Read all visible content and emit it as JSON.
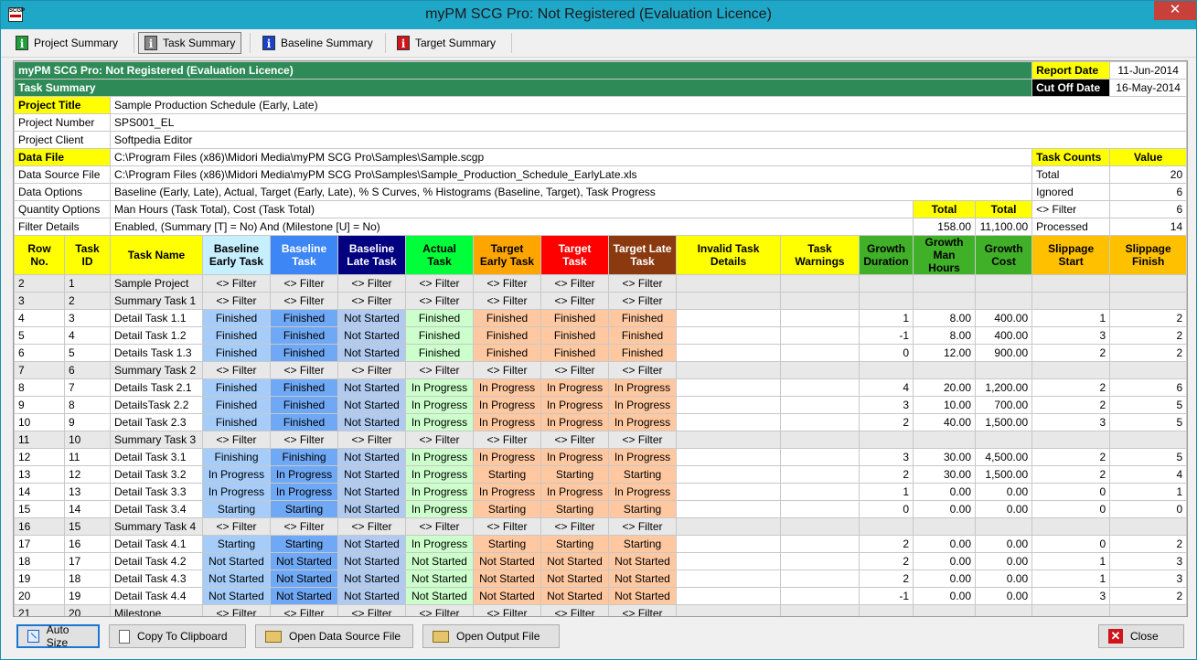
{
  "window": {
    "title": "myPM SCG Pro: Not Registered (Evaluation Licence)",
    "close": "✕"
  },
  "toolbar": [
    {
      "label": "Project Summary",
      "icon": "info-green-icon",
      "active": false
    },
    {
      "label": "Task Summary",
      "icon": "info-gray-icon",
      "active": true
    },
    {
      "label": "Baseline Summary",
      "icon": "info-blue-icon",
      "active": false
    },
    {
      "label": "Target Summary",
      "icon": "info-red-icon",
      "active": false
    }
  ],
  "header": {
    "app_line": "myPM SCG Pro: Not Registered (Evaluation Licence)",
    "sheet_title": "Task Summary",
    "report_date_label": "Report Date",
    "report_date": "11-Jun-2014",
    "cutoff_label": "Cut Off Date",
    "cutoff_date": "16-May-2014"
  },
  "project": {
    "title_label": "Project Title",
    "title": "Sample Production Schedule (Early, Late)",
    "number_label": "Project Number",
    "number": "SPS001_EL",
    "client_label": "Project Client",
    "client": "Softpedia Editor",
    "data_file_label": "Data File",
    "data_file": "C:\\Program Files (x86)\\Midori Media\\myPM SCG Pro\\Samples\\Sample.scgp",
    "source_label": "Data Source File",
    "source": "C:\\Program Files (x86)\\Midori Media\\myPM SCG Pro\\Samples\\Sample_Production_Schedule_EarlyLate.xls",
    "options_label": "Data Options",
    "options": "Baseline (Early, Late), Actual, Target (Early, Late), % S Curves, % Histograms (Baseline, Target), Task Progress",
    "qty_label": "Quantity Options",
    "qty": "Man Hours (Task Total), Cost (Task Total)",
    "filter_label": "Filter Details",
    "filter": "Enabled, (Summary [T] = No) And (Milestone [U] = No)"
  },
  "totals": {
    "label1": "Total",
    "label2": "Total",
    "value1": "158.00",
    "value2": "11,100.00"
  },
  "counts": {
    "label": "Task Counts",
    "value_label": "Value",
    "rows": [
      {
        "label": "Total",
        "value": "20"
      },
      {
        "label": "Ignored",
        "value": "6"
      },
      {
        "label": "<> Filter",
        "value": "6"
      },
      {
        "label": "Processed",
        "value": "14"
      }
    ]
  },
  "columns": {
    "row_no": "Row No.",
    "task_id": "Task ID",
    "task_name": "Task Name",
    "b_early": "Baseline Early Task",
    "base": "Baseline Task",
    "b_late": "Baseline Late Task",
    "actual": "Actual Task",
    "t_early": "Target Early Task",
    "target": "Target Task",
    "t_late": "Target Late Task",
    "invalid": "Invalid Task Details",
    "warnings": "Task Warnings",
    "g_dur": "Growth Duration",
    "g_mh": "Growth Man Hours",
    "g_cost": "Growth Cost",
    "s_start": "Slippage Start",
    "s_finish": "Slippage Finish"
  },
  "rows": [
    {
      "r": "2",
      "id": "1",
      "name": "Sample Project",
      "summ": true,
      "s": [
        "<> Filter",
        "<> Filter",
        "<> Filter",
        "<> Filter",
        "<> Filter",
        "<> Filter",
        "<> Filter"
      ],
      "gd": "",
      "gm": "",
      "gc": "",
      "ss": "",
      "sf": ""
    },
    {
      "r": "3",
      "id": "2",
      "name": "Summary Task 1",
      "summ": true,
      "s": [
        "<> Filter",
        "<> Filter",
        "<> Filter",
        "<> Filter",
        "<> Filter",
        "<> Filter",
        "<> Filter"
      ],
      "gd": "",
      "gm": "",
      "gc": "",
      "ss": "",
      "sf": ""
    },
    {
      "r": "4",
      "id": "3",
      "name": "Detail Task 1.1",
      "summ": false,
      "s": [
        "Finished",
        "Finished",
        "Not Started",
        "Finished",
        "Finished",
        "Finished",
        "Finished"
      ],
      "gd": "1",
      "gm": "8.00",
      "gc": "400.00",
      "ss": "1",
      "sf": "2"
    },
    {
      "r": "5",
      "id": "4",
      "name": "Detail Task 1.2",
      "summ": false,
      "s": [
        "Finished",
        "Finished",
        "Not Started",
        "Finished",
        "Finished",
        "Finished",
        "Finished"
      ],
      "gd": "-1",
      "gm": "8.00",
      "gc": "400.00",
      "ss": "3",
      "sf": "2"
    },
    {
      "r": "6",
      "id": "5",
      "name": "Details Task 1.3",
      "summ": false,
      "s": [
        "Finished",
        "Finished",
        "Not Started",
        "Finished",
        "Finished",
        "Finished",
        "Finished"
      ],
      "gd": "0",
      "gm": "12.00",
      "gc": "900.00",
      "ss": "2",
      "sf": "2"
    },
    {
      "r": "7",
      "id": "6",
      "name": "Summary Task 2",
      "summ": true,
      "s": [
        "<> Filter",
        "<> Filter",
        "<> Filter",
        "<> Filter",
        "<> Filter",
        "<> Filter",
        "<> Filter"
      ],
      "gd": "",
      "gm": "",
      "gc": "",
      "ss": "",
      "sf": ""
    },
    {
      "r": "8",
      "id": "7",
      "name": "Details Task 2.1",
      "summ": false,
      "s": [
        "Finished",
        "Finished",
        "Not Started",
        "In Progress",
        "In Progress",
        "In Progress",
        "In Progress"
      ],
      "gd": "4",
      "gm": "20.00",
      "gc": "1,200.00",
      "ss": "2",
      "sf": "6"
    },
    {
      "r": "9",
      "id": "8",
      "name": "DetailsTask 2.2",
      "summ": false,
      "s": [
        "Finished",
        "Finished",
        "Not Started",
        "In Progress",
        "In Progress",
        "In Progress",
        "In Progress"
      ],
      "gd": "3",
      "gm": "10.00",
      "gc": "700.00",
      "ss": "2",
      "sf": "5"
    },
    {
      "r": "10",
      "id": "9",
      "name": "Detail Task 2.3",
      "summ": false,
      "s": [
        "Finished",
        "Finished",
        "Not Started",
        "In Progress",
        "In Progress",
        "In Progress",
        "In Progress"
      ],
      "gd": "2",
      "gm": "40.00",
      "gc": "1,500.00",
      "ss": "3",
      "sf": "5"
    },
    {
      "r": "11",
      "id": "10",
      "name": "Summary Task 3",
      "summ": true,
      "s": [
        "<> Filter",
        "<> Filter",
        "<> Filter",
        "<> Filter",
        "<> Filter",
        "<> Filter",
        "<> Filter"
      ],
      "gd": "",
      "gm": "",
      "gc": "",
      "ss": "",
      "sf": ""
    },
    {
      "r": "12",
      "id": "11",
      "name": "Detail Task 3.1",
      "summ": false,
      "s": [
        "Finishing",
        "Finishing",
        "Not Started",
        "In Progress",
        "In Progress",
        "In Progress",
        "In Progress"
      ],
      "gd": "3",
      "gm": "30.00",
      "gc": "4,500.00",
      "ss": "2",
      "sf": "5"
    },
    {
      "r": "13",
      "id": "12",
      "name": "Detail Task 3.2",
      "summ": false,
      "s": [
        "In Progress",
        "In Progress",
        "Not Started",
        "In Progress",
        "Starting",
        "Starting",
        "Starting"
      ],
      "gd": "2",
      "gm": "30.00",
      "gc": "1,500.00",
      "ss": "2",
      "sf": "4"
    },
    {
      "r": "14",
      "id": "13",
      "name": "Detail Task 3.3",
      "summ": false,
      "s": [
        "In Progress",
        "In Progress",
        "Not Started",
        "In Progress",
        "In Progress",
        "In Progress",
        "In Progress"
      ],
      "gd": "1",
      "gm": "0.00",
      "gc": "0.00",
      "ss": "0",
      "sf": "1"
    },
    {
      "r": "15",
      "id": "14",
      "name": "Detail Task 3.4",
      "summ": false,
      "s": [
        "Starting",
        "Starting",
        "Not Started",
        "In Progress",
        "Starting",
        "Starting",
        "Starting"
      ],
      "gd": "0",
      "gm": "0.00",
      "gc": "0.00",
      "ss": "0",
      "sf": "0"
    },
    {
      "r": "16",
      "id": "15",
      "name": "Summary Task 4",
      "summ": true,
      "s": [
        "<> Filter",
        "<> Filter",
        "<> Filter",
        "<> Filter",
        "<> Filter",
        "<> Filter",
        "<> Filter"
      ],
      "gd": "",
      "gm": "",
      "gc": "",
      "ss": "",
      "sf": ""
    },
    {
      "r": "17",
      "id": "16",
      "name": "Detail Task 4.1",
      "summ": false,
      "s": [
        "Starting",
        "Starting",
        "Not Started",
        "In Progress",
        "Starting",
        "Starting",
        "Starting"
      ],
      "gd": "2",
      "gm": "0.00",
      "gc": "0.00",
      "ss": "0",
      "sf": "2"
    },
    {
      "r": "18",
      "id": "17",
      "name": "Detail Task 4.2",
      "summ": false,
      "s": [
        "Not Started",
        "Not Started",
        "Not Started",
        "Not Started",
        "Not Started",
        "Not Started",
        "Not Started"
      ],
      "gd": "2",
      "gm": "0.00",
      "gc": "0.00",
      "ss": "1",
      "sf": "3"
    },
    {
      "r": "19",
      "id": "18",
      "name": "Detail Task 4.3",
      "summ": false,
      "s": [
        "Not Started",
        "Not Started",
        "Not Started",
        "Not Started",
        "Not Started",
        "Not Started",
        "Not Started"
      ],
      "gd": "2",
      "gm": "0.00",
      "gc": "0.00",
      "ss": "1",
      "sf": "3"
    },
    {
      "r": "20",
      "id": "19",
      "name": "Detail Task 4.4",
      "summ": false,
      "s": [
        "Not Started",
        "Not Started",
        "Not Started",
        "Not Started",
        "Not Started",
        "Not Started",
        "Not Started"
      ],
      "gd": "-1",
      "gm": "0.00",
      "gc": "0.00",
      "ss": "3",
      "sf": "2"
    },
    {
      "r": "21",
      "id": "20",
      "name": "Milestone",
      "summ": true,
      "s": [
        "<> Filter",
        "<> Filter",
        "<> Filter",
        "<> Filter",
        "<> Filter",
        "<> Filter",
        "<> Filter"
      ],
      "gd": "",
      "gm": "",
      "gc": "",
      "ss": "",
      "sf": ""
    }
  ],
  "footer": {
    "auto_size": "Auto Size",
    "copy": "Copy To Clipboard",
    "open_source": "Open Data Source File",
    "open_output": "Open Output File",
    "close": "Close"
  }
}
